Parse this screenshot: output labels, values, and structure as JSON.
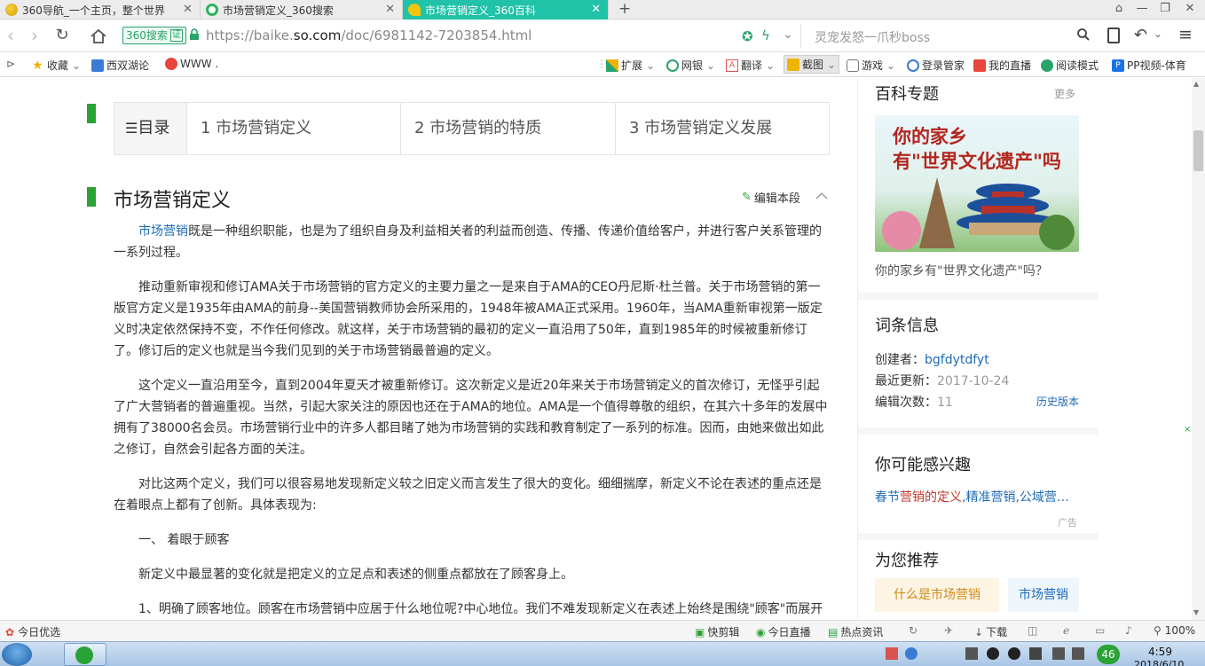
{
  "tabs": [
    {
      "title": "360导航_一个主页，整个世界",
      "active": false
    },
    {
      "title": "市场营销定义_360搜索",
      "active": false
    },
    {
      "title": "市场营销定义_360百科",
      "active": true
    }
  ],
  "address": {
    "badge": "360搜索",
    "badge_tag": "证",
    "url_prefix": "https://baike.",
    "url_domain": "so.com",
    "url_path": "/doc/6981142-7203854.html",
    "search_placeholder": "灵宠发怒一爪秒boss"
  },
  "bookmarks": {
    "left": [
      "收藏",
      "西双湖论",
      "WWW ."
    ],
    "right": [
      "扩展",
      "网银",
      "翻译",
      "截图",
      "游戏",
      "登录管家",
      "我的直播",
      "阅读模式",
      "PP视频-体育"
    ]
  },
  "toc": {
    "label": "目录",
    "items": [
      "1 市场营销定义",
      "2 市场营销的特质",
      "3 市场营销定义发展"
    ]
  },
  "section": {
    "title": "市场营销定义",
    "edit_label": "编辑本段",
    "link_term": "市场营销",
    "p1_rest": "既是一种组织职能，也是为了组织自身及利益相关者的利益而创造、传播、传递价值给客户，并进行客户关系管理的一系列过程。",
    "p2": "推动重新审视和修订AMA关于市场营销的官方定义的主要力量之一是来自于AMA的CEO丹尼斯·杜兰普。关于市场营销的第一版官方定义是1935年由AMA的前身--美国营销教师协会所采用的，1948年被AMA正式采用。1960年，当AMA重新审视第一版定义时决定依然保持不变，不作任何修改。就这样，关于市场营销的最初的定义一直沿用了50年，直到1985年的时候被重新修订了。修订后的定义也就是当今我们见到的关于市场营销最普遍的定义。",
    "p3": "这个定义一直沿用至今，直到2004年夏天才被重新修订。这次新定义是近20年来关于市场营销定义的首次修订，无怪乎引起了广大营销者的普遍重视。当然，引起大家关注的原因也还在于AMA的地位。AMA是一个值得尊敬的组织，在其六十多年的发展中拥有了38000名会员。市场营销行业中的许多人都目睹了她为市场营销的实践和教育制定了一系列的标准。因而，由她来做出如此之修订，自然会引起各方面的关注。",
    "p4": "对比这两个定义，我们可以很容易地发现新定义较之旧定义而言发生了很大的变化。细细揣摩，新定义不论在表述的重点还是在着眼点上都有了创新。具体表现为:",
    "p5": "一、 着眼于顾客",
    "p6": "新定义中最显著的变化就是把定义的立足点和表述的侧重点都放在了顾客身上。",
    "p7": "1、明确了顾客地位。顾客在市场营销中应居于什么地位呢?中心地位。我们不难发现新定义在表述上始终是围绕\"顾客\"而展开"
  },
  "sidebar": {
    "topic_title": "百科专题",
    "topic_more": "更多",
    "banner_line1": "你的家乡",
    "banner_line2": "有\"世界文化遗产\"吗",
    "banner_caption": "你的家乡有\"世界文化遗产\"吗？",
    "info_title": "词条信息",
    "creator_label": "创建者：",
    "creator": "bgfdytdfyt",
    "updated_label": "最近更新：",
    "updated": "2017-10-24",
    "edits_label": "编辑次数：",
    "edits": "11",
    "history": "历史版本",
    "interest_title": "你可能感兴趣",
    "interest_a": "春节",
    "interest_b": "营销的定义",
    "interest_c": ",精准营销,公域营…",
    "ad": "广告",
    "recommend_title": "为您推荐",
    "rec1": "什么是市场营销",
    "rec2": "市场营销"
  },
  "status": {
    "left": "今日优选",
    "items": [
      "快剪辑",
      "今日直播",
      "热点资讯",
      "下载"
    ],
    "zoom": "100%"
  },
  "taskbar": {
    "clock": "4:59",
    "date": "2018/6/10",
    "badge": "46"
  }
}
